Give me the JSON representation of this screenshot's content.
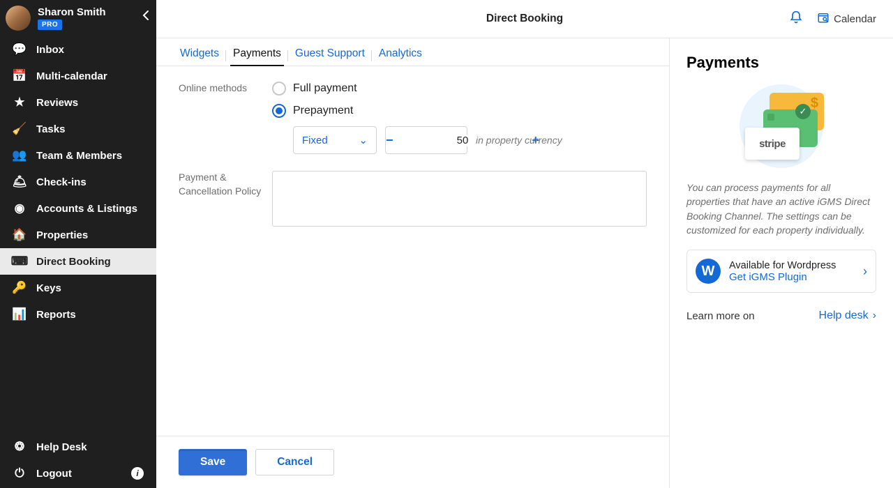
{
  "user": {
    "name": "Sharon Smith",
    "badge": "PRO"
  },
  "sidebar": {
    "items": [
      {
        "label": "Inbox",
        "icon": "chat"
      },
      {
        "label": "Multi-calendar",
        "icon": "calendar"
      },
      {
        "label": "Reviews",
        "icon": "star"
      },
      {
        "label": "Tasks",
        "icon": "broom"
      },
      {
        "label": "Team & Members",
        "icon": "team"
      },
      {
        "label": "Check-ins",
        "icon": "bell"
      },
      {
        "label": "Accounts & Listings",
        "icon": "account"
      },
      {
        "label": "Properties",
        "icon": "home"
      },
      {
        "label": "Direct Booking",
        "icon": "code"
      },
      {
        "label": "Keys",
        "icon": "key"
      },
      {
        "label": "Reports",
        "icon": "chart"
      }
    ],
    "bottom": [
      {
        "label": "Help Desk",
        "icon": "life"
      },
      {
        "label": "Logout",
        "icon": "power"
      }
    ]
  },
  "header": {
    "title": "Direct Booking",
    "calendar": "Calendar"
  },
  "tabs": [
    "Widgets",
    "Payments",
    "Guest Support",
    "Analytics"
  ],
  "form": {
    "onlineMethodsLabel": "Online methods",
    "fullPayment": "Full payment",
    "prepayment": "Prepayment",
    "selectValue": "Fixed",
    "stepperValue": "50",
    "hint": "in property currency",
    "policyLabel": "Payment & Cancellation Policy",
    "policyValue": ""
  },
  "footer": {
    "save": "Save",
    "cancel": "Cancel"
  },
  "panel": {
    "title": "Payments",
    "stripe": "stripe",
    "desc": "You can process payments for all properties that have an active iGMS Direct Booking Channel. The settings can be customized for each property individually.",
    "wpAvailable": "Available for Wordpress",
    "wpGet": "Get iGMS Plugin",
    "learnLabel": "Learn more on",
    "helpDesk": "Help desk"
  }
}
